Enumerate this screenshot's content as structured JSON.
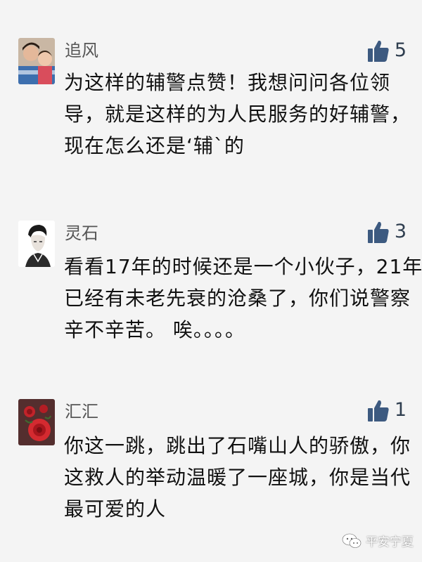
{
  "comments": [
    {
      "name": "追风",
      "likes": "5",
      "lines": [
        "为这样的辅警点赞！我想问问各位领",
        "导，就是这样的为人民服务的好辅警，",
        "现在怎么还是‘辅`的"
      ]
    },
    {
      "name": "灵石",
      "likes": "3",
      "lines": [
        "看看17年的时候还是一个小伙子，21年",
        "已经有未老先衰的沧桑了，你们说警察",
        "辛不辛苦。 唉。。。。"
      ]
    },
    {
      "name": "汇汇",
      "likes": "1",
      "lines": [
        "你这一跳，跳出了石嘴山人的骄傲，你",
        "这救人的举动温暖了一座城，你是当代",
        "最可爱的人"
      ]
    }
  ],
  "watermark": {
    "text": "平安宁夏"
  },
  "colors": {
    "background": "#f4f4f4",
    "name": "#555555",
    "text": "#111111",
    "like_icon": "#3d5a80"
  },
  "icons": {
    "like": "thumbs-up-icon",
    "watermark": "wechat-icon"
  }
}
